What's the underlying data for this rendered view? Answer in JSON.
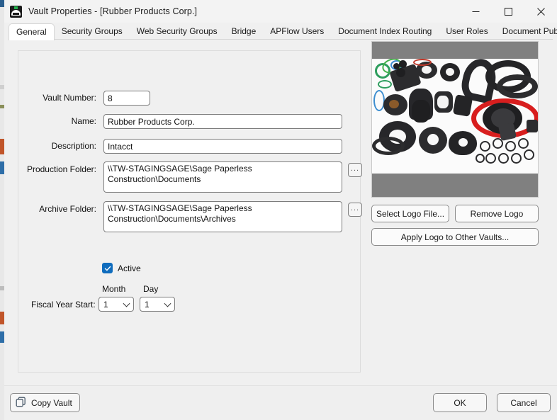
{
  "window": {
    "title": "Vault Properties - [Rubber Products Corp.]",
    "app_icon": "vault-app-icon",
    "controls": {
      "minimize": "minimize-icon",
      "maximize": "maximize-icon",
      "close": "close-icon"
    }
  },
  "tabs": [
    {
      "label": "General",
      "selected": true
    },
    {
      "label": "Security Groups",
      "selected": false
    },
    {
      "label": "Web Security Groups",
      "selected": false
    },
    {
      "label": "Bridge",
      "selected": false
    },
    {
      "label": "APFlow Users",
      "selected": false
    },
    {
      "label": "Document Index Routing",
      "selected": false
    },
    {
      "label": "User Roles",
      "selected": false
    },
    {
      "label": "Document Publishing",
      "selected": false
    }
  ],
  "form": {
    "vault_number": {
      "label": "Vault Number:",
      "value": "8"
    },
    "name": {
      "label": "Name:",
      "value": "Rubber Products Corp."
    },
    "description": {
      "label": "Description:",
      "value": "Intacct"
    },
    "production_folder": {
      "label": "Production Folder:",
      "value": "\\\\TW-STAGINGSAGE\\Sage Paperless Construction\\Documents",
      "browse_label": "..."
    },
    "archive_folder": {
      "label": "Archive Folder:",
      "value": "\\\\TW-STAGINGSAGE\\Sage Paperless Construction\\Documents\\Archives",
      "browse_label": "..."
    },
    "active": {
      "label": "Active",
      "checked": true
    },
    "fiscal_year_start": {
      "label": "Fiscal Year Start:",
      "month_header": "Month",
      "day_header": "Day",
      "month_value": "1",
      "day_value": "1"
    }
  },
  "logo": {
    "alt": "rubber-products-photo",
    "select_button": "Select Logo File...",
    "remove_button": "Remove Logo",
    "apply_button": "Apply Logo to Other Vaults...",
    "background_color": "#808080"
  },
  "footer": {
    "copy_vault": "Copy Vault",
    "copy_icon": "copy-icon",
    "ok": "OK",
    "cancel": "Cancel"
  },
  "colors": {
    "accent": "#0f6cbd",
    "window_bg": "#f0f0f0",
    "field_border": "#7c7c7c"
  }
}
